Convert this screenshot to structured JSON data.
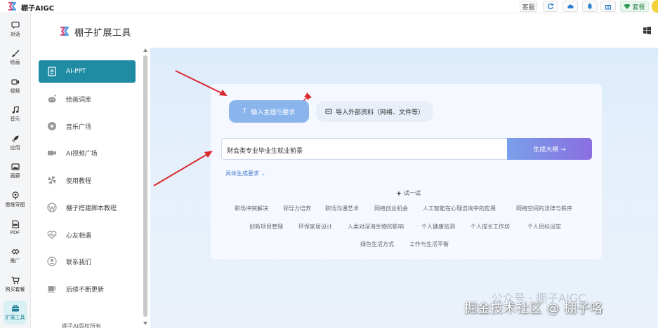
{
  "app": {
    "title": "棚子AIGC",
    "top_buttons": {
      "service": "客服",
      "vip": "套餐",
      "icons": [
        "refresh-icon",
        "cloud-icon",
        "bell-icon",
        "gift-icon",
        "diamond-icon"
      ]
    }
  },
  "rail": {
    "items": [
      {
        "label": "对话",
        "icon": "chat-icon"
      },
      {
        "label": "绘画",
        "icon": "brush-icon"
      },
      {
        "label": "视频",
        "icon": "video-icon"
      },
      {
        "label": "音乐",
        "icon": "music-icon"
      },
      {
        "label": "应用",
        "icon": "rocket-icon"
      },
      {
        "label": "画廊",
        "icon": "gallery-icon"
      },
      {
        "label": "思维导图",
        "icon": "mindmap-icon"
      },
      {
        "label": "PDF",
        "icon": "pdf-icon"
      },
      {
        "label": "推广",
        "icon": "share-icon"
      },
      {
        "label": "购买套餐",
        "icon": "cart-icon"
      },
      {
        "label": "扩展工具",
        "icon": "toolbox-icon",
        "active": true
      }
    ]
  },
  "panel": {
    "title": "棚子扩展工具",
    "items": [
      {
        "label": "AI-PPT",
        "icon": "document-icon",
        "active": true
      },
      {
        "label": "绘画词库",
        "icon": "reddit-icon"
      },
      {
        "label": "音乐广场",
        "icon": "play-icon"
      },
      {
        "label": "AI视频广场",
        "icon": "video-camera-icon"
      },
      {
        "label": "使用教程",
        "icon": "pinwheel-icon"
      },
      {
        "label": "棚子搭建脚本教程",
        "icon": "wordpress-icon"
      },
      {
        "label": "心友相遇",
        "icon": "heartbeat-icon"
      },
      {
        "label": "联系我们",
        "icon": "user-icon"
      },
      {
        "label": "后续不断更新",
        "icon": "coffee-icon"
      }
    ],
    "copyright": "棚子AI版权所有"
  },
  "main": {
    "tab_topic": "输入主题与要求",
    "tab_import": "导入外部资料（网络、文件等）",
    "input_value": "财会类专业毕业生就业前景",
    "generate_button": "生成大纲 →",
    "detail_link": "具体生成要求 ⌄",
    "try_label": "试一试",
    "suggestions": [
      "职场冲突解决",
      "领导力培养",
      "职场沟通艺术",
      "网络创业机会",
      "人工智能在心理咨询中的应用",
      "网络空间的法律与秩序",
      "创新项目管理",
      "环保家居设计",
      "人类对深海生物的影响",
      "个人健康监测",
      "个人成长工作坊",
      "个人目标设定",
      "绿色生活方式",
      "工作与生活平衡"
    ]
  },
  "watermark": {
    "faint": "公众号 · 棚子AIGC",
    "main": "掘金技术社区 @ 棚子咯"
  },
  "colors": {
    "accent": "#1f8ca3",
    "tab_active": "#8ab4ec",
    "generate_gradient_start": "#7aa0ea",
    "generate_gradient_end": "#8a6ee0",
    "annotation_arrow": "#d9272e"
  }
}
